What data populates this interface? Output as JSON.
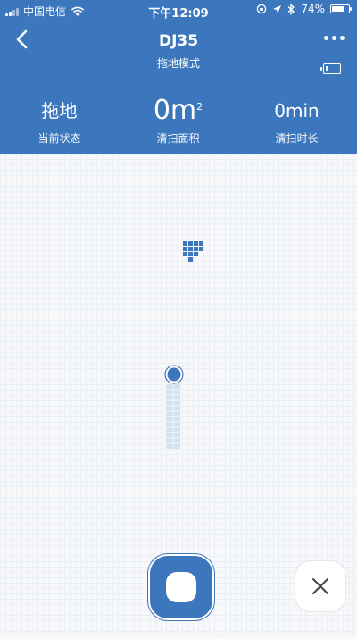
{
  "status_bar": {
    "carrier": "中国电信",
    "time": "下午12:09",
    "battery_percent": "74%",
    "battery_level": 0.74
  },
  "header": {
    "title": "DJ35",
    "subtitle": "拖地模式",
    "robot_battery_level": 0.15
  },
  "stats": {
    "state": {
      "value": "拖地",
      "label": "当前状态"
    },
    "area": {
      "value": "0m",
      "unit_sup": "2",
      "label": "清扫面积"
    },
    "duration": {
      "value": "0min",
      "label": "清扫时长"
    }
  },
  "colors": {
    "primary": "#3c77bd",
    "map_bg": "#f7f8fa",
    "path": "#d6e1ef"
  },
  "icons": {
    "back": "chevron-left-icon",
    "more": "more-icon",
    "close": "close-icon",
    "start": "start-stop-icon"
  }
}
